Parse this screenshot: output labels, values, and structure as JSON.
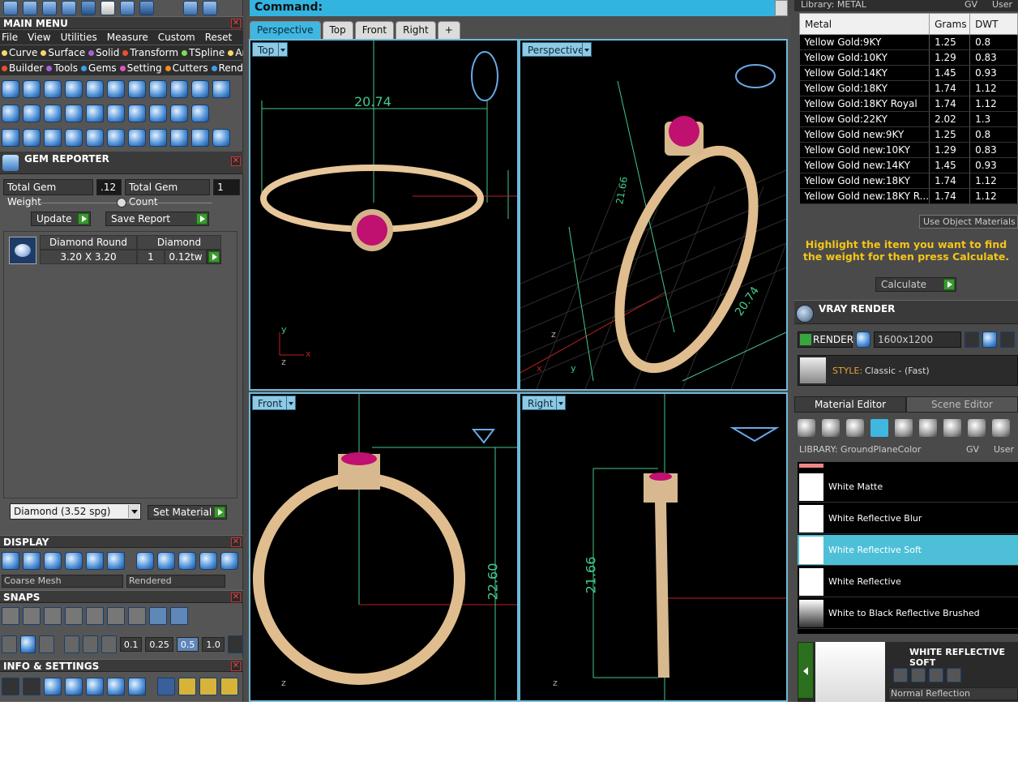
{
  "main_menu": {
    "title": "MAIN MENU",
    "menu": [
      "File",
      "View",
      "Utilities",
      "Measure",
      "Custom"
    ],
    "reset": "Reset",
    "categories_row1": [
      {
        "label": "Curve",
        "color": "#f5d76e"
      },
      {
        "label": "Surface",
        "color": "#f5d76e"
      },
      {
        "label": "Solid",
        "color": "#a760d8"
      },
      {
        "label": "Transform",
        "color": "#e5532d"
      },
      {
        "label": "TSpline",
        "color": "#7ed957"
      },
      {
        "label": "Art",
        "color": "#f5d76e"
      }
    ],
    "categories_row2": [
      {
        "label": "Builder",
        "color": "#e5532d"
      },
      {
        "label": "Tools",
        "color": "#a760d8"
      },
      {
        "label": "Gems",
        "color": "#3aa0e8"
      },
      {
        "label": "Setting",
        "color": "#e055c0"
      },
      {
        "label": "Cutters",
        "color": "#f08a2c"
      },
      {
        "label": "Render",
        "color": "#3aa0e8"
      }
    ]
  },
  "gem_reporter": {
    "title": "GEM REPORTER",
    "total_weight_label": "Total Gem Weight",
    "total_weight_value": ".12",
    "total_count_label": "Total Gem Count",
    "total_count_value": "1",
    "update_label": "Update",
    "save_label": "Save Report",
    "gem": {
      "name": "Diamond Round",
      "material": "Diamond",
      "size": "3.20 X 3.20",
      "count": "1",
      "weight": "0.12tw"
    },
    "material_select": "Diamond    (3.52 spg)",
    "set_material_label": "Set Material"
  },
  "display": {
    "title": "DISPLAY",
    "mesh_select": "Coarse Mesh",
    "render_select": "Rendered"
  },
  "snaps": {
    "title": "SNAPS",
    "increments": [
      "0.1",
      "0.25",
      "0.5",
      "1.0"
    ]
  },
  "info_settings": {
    "title": "INFO & SETTINGS"
  },
  "command": {
    "label": "Command:"
  },
  "view_tabs": [
    "Perspective",
    "Top",
    "Front",
    "Right",
    "+"
  ],
  "viewports": {
    "top": {
      "label": "Top",
      "dim": "20.74",
      "axis_x": "x",
      "axis_y": "y",
      "axis_z": "z"
    },
    "perspective": {
      "label": "Perspective",
      "dim1": "21.66",
      "dim2": "20.74",
      "axis_x": "x",
      "axis_y": "y",
      "axis_z": "z"
    },
    "front": {
      "label": "Front",
      "dim": "22.60",
      "axis_z": "z"
    },
    "right": {
      "label": "Right",
      "dim": "21.66",
      "axis_z": "z"
    }
  },
  "metal_library": {
    "title": "Library: METAL",
    "gv": "GV",
    "user": "User",
    "columns": [
      "Metal",
      "Grams",
      "DWT"
    ],
    "rows": [
      [
        "Yellow Gold:9KY",
        "1.25",
        "0.8"
      ],
      [
        "Yellow Gold:10KY",
        "1.29",
        "0.83"
      ],
      [
        "Yellow Gold:14KY",
        "1.45",
        "0.93"
      ],
      [
        "Yellow Gold:18KY",
        "1.74",
        "1.12"
      ],
      [
        "Yellow Gold:18KY Royal",
        "1.74",
        "1.12"
      ],
      [
        "Yellow Gold:22KY",
        "2.02",
        "1.3"
      ],
      [
        "Yellow Gold new:9KY",
        "1.25",
        "0.8"
      ],
      [
        "Yellow Gold new:10KY",
        "1.29",
        "0.83"
      ],
      [
        "Yellow Gold new:14KY",
        "1.45",
        "0.93"
      ],
      [
        "Yellow Gold new:18KY",
        "1.74",
        "1.12"
      ],
      [
        "Yellow Gold new:18KY R...",
        "1.74",
        "1.12"
      ]
    ],
    "use_object_materials": "Use Object Materials",
    "highlight_text": "Highlight the item you want to find the weight for then press Calculate.",
    "calculate_label": "Calculate"
  },
  "vray": {
    "title": "VRAY RENDER",
    "render_label": "RENDER",
    "resolution": "1600x1200",
    "style_label": "STYLE:",
    "style_value": "Classic - (Fast)"
  },
  "material_editor": {
    "tab_active": "Material Editor",
    "tab_other": "Scene Editor",
    "library_label": "LIBRARY: GroundPlaneColor",
    "gv": "GV",
    "user": "User",
    "items": [
      {
        "name": "White Matte",
        "selected": false
      },
      {
        "name": "White Reflective Blur",
        "selected": false
      },
      {
        "name": "White Reflective Soft",
        "selected": true
      },
      {
        "name": "White Reflective",
        "selected": false
      },
      {
        "name": "White to Black Reflective Brushed",
        "selected": false
      }
    ],
    "preview_title": "WHITE REFLECTIVE SOFT",
    "reflection_select": "Normal Reflection"
  },
  "colors": {
    "accent": "#3fb7e1",
    "gold": "#e8c79a",
    "ruby": "#c01070",
    "dimension": "#43c98a"
  }
}
